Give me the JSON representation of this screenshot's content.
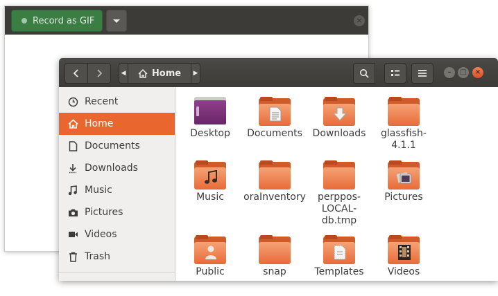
{
  "peek": {
    "record_label": "Record as GIF"
  },
  "files": {
    "breadcrumb": {
      "current": "Home"
    },
    "sidebar": {
      "items": [
        {
          "label": "Recent",
          "icon": "clock-icon",
          "active": false
        },
        {
          "label": "Home",
          "icon": "home-icon",
          "active": true
        },
        {
          "label": "Documents",
          "icon": "document-icon",
          "active": false
        },
        {
          "label": "Downloads",
          "icon": "download-icon",
          "active": false
        },
        {
          "label": "Music",
          "icon": "music-note-icon",
          "active": false
        },
        {
          "label": "Pictures",
          "icon": "camera-icon",
          "active": false
        },
        {
          "label": "Videos",
          "icon": "video-icon",
          "active": false
        },
        {
          "label": "Trash",
          "icon": "trash-icon",
          "active": false
        }
      ]
    },
    "items": [
      {
        "label": "Desktop",
        "icon": "desktop-folder-icon"
      },
      {
        "label": "Documents",
        "icon": "documents-folder-icon"
      },
      {
        "label": "Downloads",
        "icon": "downloads-folder-icon"
      },
      {
        "label": "glassfish-4.1.1",
        "icon": "folder-icon"
      },
      {
        "label": "Music",
        "icon": "music-folder-icon"
      },
      {
        "label": "oraInventory",
        "icon": "folder-icon"
      },
      {
        "label": "perppos-LOCAL-db.tmp",
        "icon": "folder-icon"
      },
      {
        "label": "Pictures",
        "icon": "pictures-folder-icon"
      },
      {
        "label": "Public",
        "icon": "public-folder-icon"
      },
      {
        "label": "snap",
        "icon": "folder-icon"
      },
      {
        "label": "Templates",
        "icon": "templates-folder-icon"
      },
      {
        "label": "Videos",
        "icon": "videos-folder-icon"
      }
    ],
    "colors": {
      "accent": "#e9672f",
      "headerbar": "#3c3b37",
      "record_green": "#3b7e43"
    }
  }
}
